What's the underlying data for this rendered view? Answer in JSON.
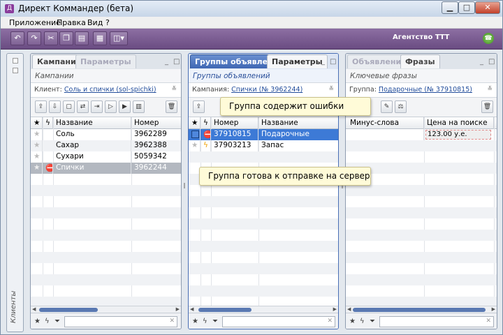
{
  "window": {
    "title": "Директ Коммандер (бета)",
    "minimize": "▁",
    "maximize": "□",
    "close": "✕"
  },
  "menu": [
    "Приложение",
    "Правка",
    "Вид",
    "?"
  ],
  "toolbar": {
    "agency": "Агентство ТТТ",
    "buttons": [
      "undo-icon",
      "redo-icon",
      "cut-icon",
      "copy-icon",
      "paste-icon",
      "table-icon",
      "columns-icon"
    ]
  },
  "sidebar": {
    "label": "Клиенты"
  },
  "campaigns_panel": {
    "tabs": [
      "Кампании",
      "Параметры"
    ],
    "subtitle": "Кампании",
    "filter_label": "Клиент:",
    "filter_value": "Соль и спички (sol-spichki)",
    "columns": [
      "Название",
      "Номер"
    ],
    "rows": [
      {
        "name": "Соль",
        "number": "3962289",
        "state": ""
      },
      {
        "name": "Сахар",
        "number": "3962388",
        "state": ""
      },
      {
        "name": "Сухари",
        "number": "5059342",
        "state": ""
      },
      {
        "name": "Спички",
        "number": "3962244",
        "state": "error"
      }
    ]
  },
  "groups_panel": {
    "tabs": [
      "Группы объявлений",
      "Параметры"
    ],
    "subtitle": "Группы объявлений",
    "filter_label": "Кампания:",
    "filter_value": "Спички (№ 3962244)",
    "columns": [
      "Номер",
      "Название"
    ],
    "rows": [
      {
        "number": "37910815",
        "name": "Подарочные",
        "state": "error"
      },
      {
        "number": "37903213",
        "name": "Запас",
        "state": "ready"
      }
    ]
  },
  "phrases_panel": {
    "tabs": [
      "Объявления",
      "Фразы"
    ],
    "subtitle": "Ключевые фразы",
    "filter_label": "Группа:",
    "filter_value": "Подарочные (№ 37910815)",
    "columns": [
      "Минус-слова",
      "Цена на поиске"
    ],
    "rows": [
      {
        "minus": "",
        "price": "123.00 у.е."
      }
    ]
  },
  "tooltips": {
    "error": "Группа содержит ошибки",
    "ready": "Группа готова к отправке на сервер"
  },
  "colors": {
    "toolbar": "#7a5c92",
    "selection": "#3d7ad6",
    "accent_tab": "#3e66b3"
  }
}
